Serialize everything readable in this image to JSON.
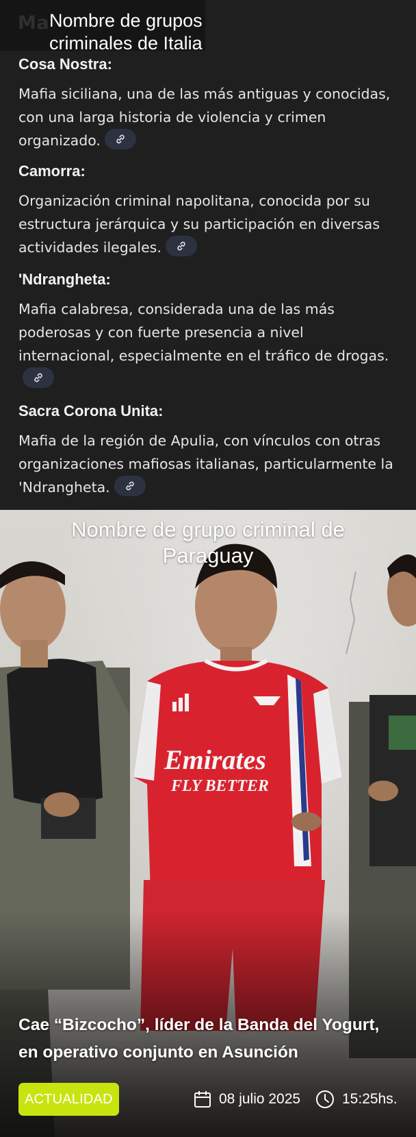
{
  "overlay": {
    "title": "Nombre de grupos criminales de Italia",
    "title_line1": "Nombre de grupos",
    "title_line2": "criminales de Italia",
    "ghost_text": "Ma"
  },
  "groups": [
    {
      "name": "Cosa Nostra:",
      "description": "Mafia siciliana, una de las más antiguas y conocidas, con una larga historia de violencia y crimen organizado.",
      "link_icon": "link-icon"
    },
    {
      "name": "Camorra:",
      "description": "Organización criminal napolitana, conocida por su estructura jerárquica y su participación en diversas actividades ilegales.",
      "link_icon": "link-icon"
    },
    {
      "name": "'Ndrangheta:",
      "description": "Mafia calabresa, considerada una de las más poderosas y con fuerte presencia a nivel internacional, especialmente en el tráfico de drogas.",
      "link_icon": "link-icon"
    },
    {
      "name": "Sacra Corona Unita:",
      "description": "Mafia de la región de Apulia, con vínculos con otras organizaciones mafiosas italianas, particularmente la 'Ndrangheta.",
      "link_icon": "link-icon"
    }
  ],
  "photo": {
    "title_line1": "Nombre de grupo criminal de",
    "title_line2": "Paraguay",
    "jersey_sponsor_line1": "Emirates",
    "jersey_sponsor_line2": "FLY BETTER"
  },
  "article": {
    "headline": "Cae “Bizcocho”, líder de la Banda del Yogurt, en operativo conjunto en Asunción",
    "category": "ACTUALIDAD",
    "date": "08 julio 2025",
    "time": "15:25hs.",
    "date_icon": "calendar-icon",
    "time_icon": "clock-icon"
  },
  "colors": {
    "background": "#1f1f1f",
    "link_chip": "#2c3240",
    "category_badge": "#c8e410",
    "jersey_red": "#d8232f"
  }
}
